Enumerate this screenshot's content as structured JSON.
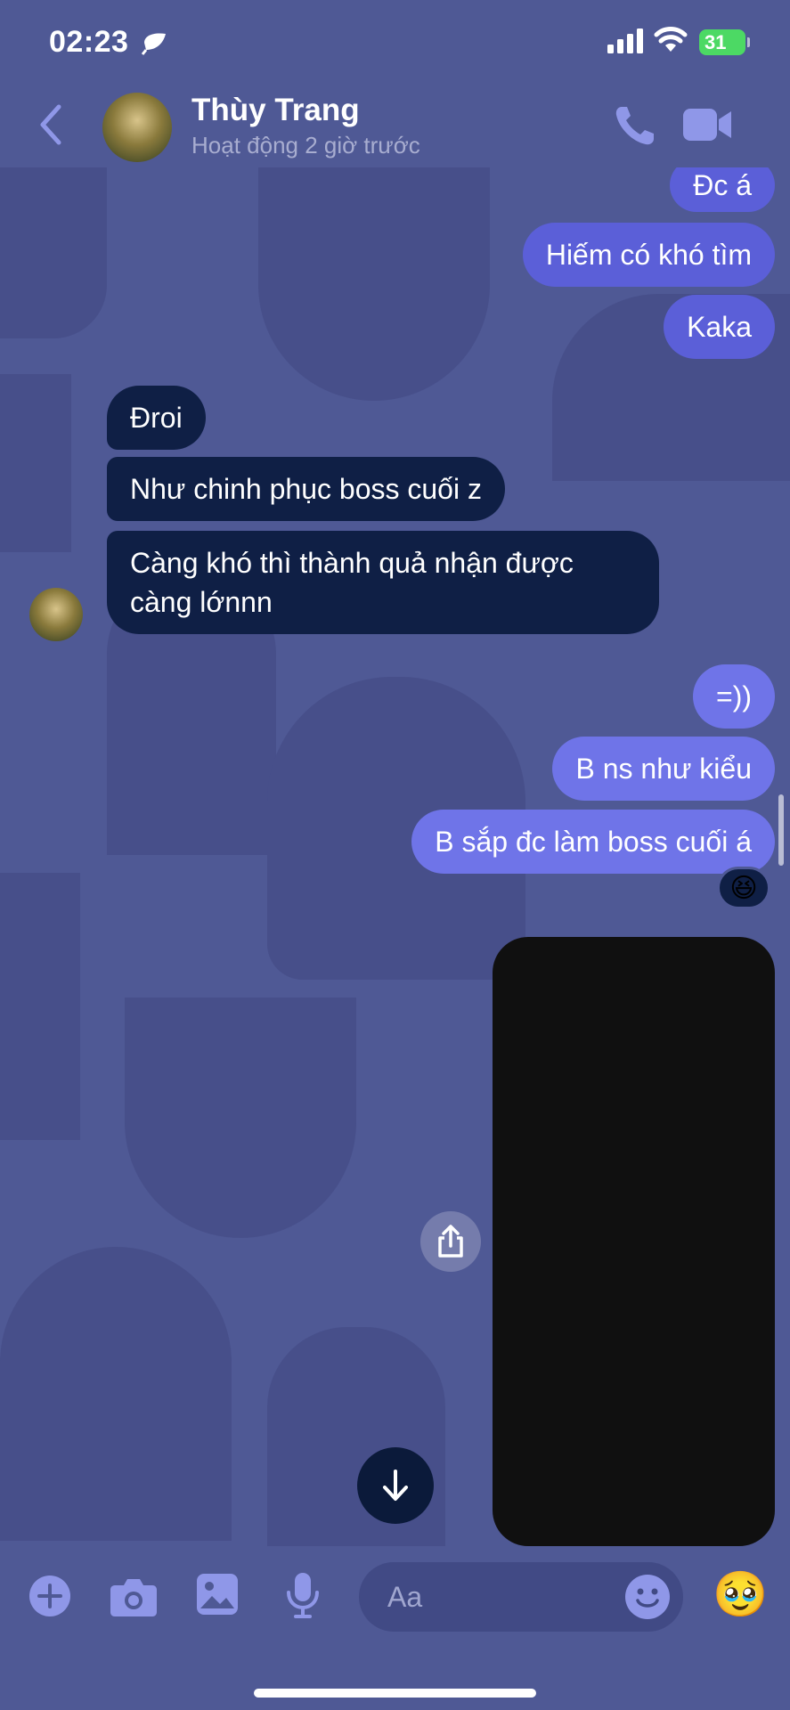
{
  "status_bar": {
    "time": "02:23",
    "battery": "31"
  },
  "header": {
    "name": "Thùy Trang",
    "subtitle": "Hoạt động 2 giờ trước",
    "back_icon": "chevron-left-icon",
    "call_icon": "phone-icon",
    "video_icon": "video-camera-icon"
  },
  "messages": {
    "out_1": "Đc á",
    "out_2": "Hiếm có khó tìm",
    "out_3": "Kaka",
    "in_1": "Đroi",
    "in_2": "Như chinh phục boss cuối z",
    "in_3": "Càng khó thì thành quả nhận được càng lớnnn",
    "out_4": "=))",
    "out_5": "B ns như kiểu",
    "out_6": "B sắp đc làm boss cuối á",
    "reaction": "😆"
  },
  "composer": {
    "placeholder": "Aa",
    "quick_emoji": "🥹"
  },
  "colors": {
    "background": "#4f5995",
    "outgoing_bubble": "#5b5fd8",
    "incoming_bubble": "#0f1f45"
  }
}
